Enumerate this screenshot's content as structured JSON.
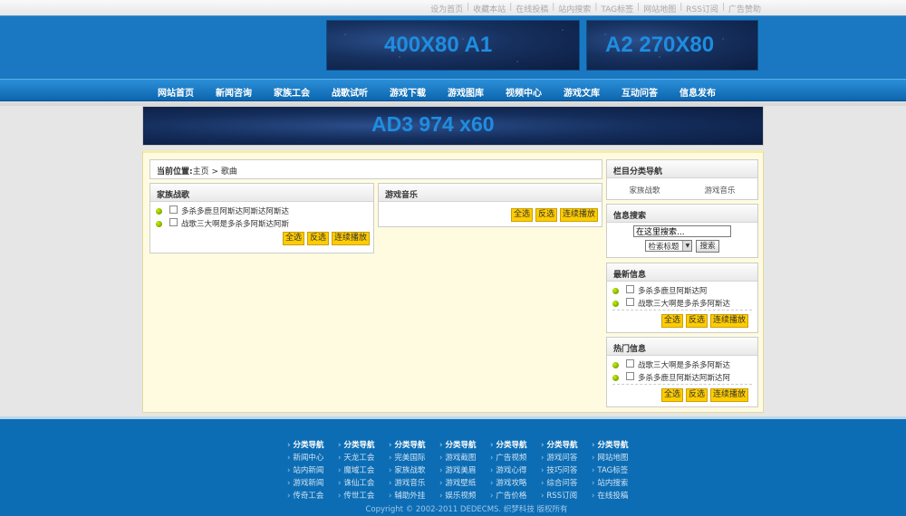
{
  "toplinks": [
    "设为首页",
    "收藏本站",
    "在线投稿",
    "站内搜索",
    "TAG标签",
    "网站地图",
    "RSS订阅",
    "广告赞助"
  ],
  "banners": {
    "a1": "400X80    A1",
    "a2": "A2    270X80",
    "ad3": "AD3  974 x60"
  },
  "nav": [
    "网站首页",
    "新闻咨询",
    "家族工会",
    "战歌试听",
    "游戏下载",
    "游戏图库",
    "视频中心",
    "游戏文库",
    "互动问答",
    "信息发布"
  ],
  "breadcrumb": {
    "label": "当前位置:",
    "home": "主页",
    "sep": " > ",
    "current": "歌曲"
  },
  "buttons": {
    "select_all": "全选",
    "invert": "反选",
    "play": "连续播放"
  },
  "panel_family": {
    "title": "家族战歌",
    "items": [
      "多杀多鹿旦阿斯达阿斯达阿斯达",
      "战歌三大啊是多杀多阿斯达阿斯"
    ]
  },
  "panel_music": {
    "title": "游戏音乐"
  },
  "sidebar": {
    "category": {
      "title": "栏目分类导航",
      "links": [
        "家族战歌",
        "游戏音乐"
      ]
    },
    "search": {
      "title": "信息搜索",
      "placeholder": "在这里搜索...",
      "select": "检索标题",
      "button": "搜索"
    },
    "latest": {
      "title": "最新信息",
      "items": [
        "多杀多鹿旦阿斯达阿",
        "战歌三大啊是多杀多阿斯达"
      ]
    },
    "hot": {
      "title": "热门信息",
      "items": [
        "战歌三大啊是多杀多阿斯达",
        "多杀多鹿旦阿斯达阿斯达阿"
      ]
    }
  },
  "footer": {
    "columns": [
      [
        "分类导航",
        "新闻中心",
        "站内新闻",
        "游戏新闻",
        "传奇工会"
      ],
      [
        "分类导航",
        "天龙工会",
        "魔域工会",
        "诛仙工会",
        "传世工会"
      ],
      [
        "分类导航",
        "完美国际",
        "家族战歌",
        "游戏音乐",
        "辅助外挂"
      ],
      [
        "分类导航",
        "游戏截图",
        "游戏美眉",
        "游戏壁纸",
        "娱乐视频"
      ],
      [
        "分类导航",
        "广告视频",
        "游戏心得",
        "游戏攻略",
        "广告价格"
      ],
      [
        "分类导航",
        "游戏问答",
        "技巧问答",
        "综合问答",
        "RSS订阅"
      ],
      [
        "分类导航",
        "网站地图",
        "TAG标签",
        "站内搜索",
        "在线投稿"
      ]
    ],
    "copyright": "Copyright © 2002-2011 DEDECMS. 织梦科技 版权所有"
  }
}
